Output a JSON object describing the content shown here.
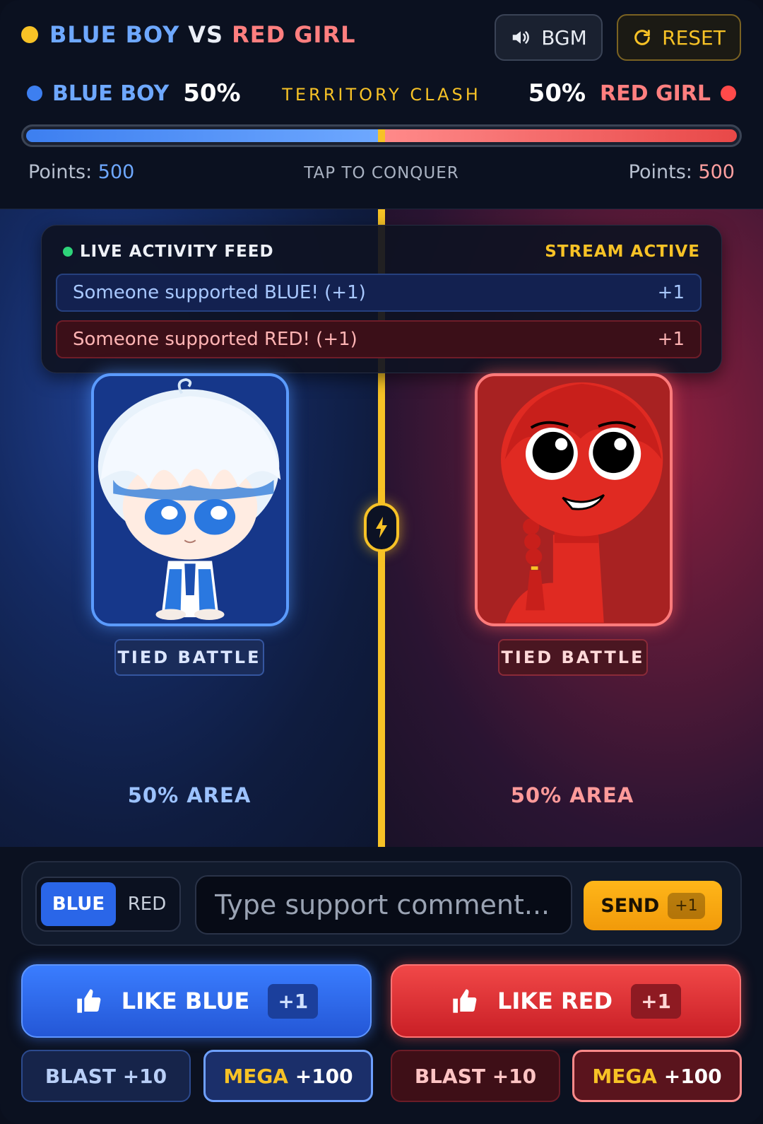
{
  "header": {
    "title_blue": "BLUE BOY",
    "title_vs": "VS",
    "title_red": "RED GIRL",
    "bgm_label": "BGM",
    "reset_label": "RESET"
  },
  "score": {
    "blue_name": "BLUE BOY",
    "blue_pct": "50%",
    "blue_fraction": 0.5,
    "clash_label": "TERRITORY CLASH",
    "red_pct": "50%",
    "red_name": "RED GIRL",
    "points_label": "Points:",
    "blue_points": "500",
    "red_points": "500",
    "tap_label": "TAP TO CONQUER"
  },
  "feed": {
    "title": "LIVE ACTIVITY FEED",
    "status": "STREAM ACTIVE",
    "items": [
      {
        "text": "Someone supported BLUE! (+1)",
        "delta": "+1",
        "team": "blue"
      },
      {
        "text": "Someone supported RED! (+1)",
        "delta": "+1",
        "team": "red"
      }
    ]
  },
  "arena": {
    "blue_status": "TIED BATTLE",
    "red_status": "TIED BATTLE",
    "blue_area": "50% AREA",
    "red_area": "50% AREA"
  },
  "comment": {
    "toggle_blue": "BLUE",
    "toggle_red": "RED",
    "placeholder": "Type support comment...",
    "value": "",
    "send_label": "SEND",
    "send_badge": "+1"
  },
  "actions": {
    "like_blue": "LIKE BLUE",
    "like_blue_badge": "+1",
    "like_red": "LIKE RED",
    "like_red_badge": "+1",
    "blast_word": "BLAST",
    "blast_val": "+10",
    "mega_word": "MEGA",
    "mega_val": "+100"
  },
  "colors": {
    "blue": "#3d7ff0",
    "red": "#e84848",
    "accent": "#f7c226"
  }
}
